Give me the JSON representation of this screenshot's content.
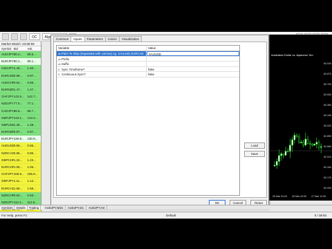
{
  "market_watch": {
    "title": "Market Watch: 23:58:59",
    "headers": [
      "Symbol",
      "Bid",
      "Ask"
    ],
    "rows": [
      {
        "symbol": "AUDJPY",
        "bid": "80.4...",
        "ask": "80.5...",
        "color": "#7ee07e"
      },
      {
        "symbol": "EURJPY",
        "bid": "90.1...",
        "ask": "90.1...",
        "color": "#e8ffe8"
      },
      {
        "symbol": "USDJPY",
        "bid": "1.40...",
        "ask": "1.40...",
        "color": "#7ee07e"
      },
      {
        "symbol": "EURUSD",
        "bid": "0.98...",
        "ask": "0.97...",
        "color": "#7ee07e"
      },
      {
        "symbol": "AUDCHF",
        "bid": "0.64...",
        "ask": "0.65...",
        "color": "#7ee07e"
      },
      {
        "symbol": "EURNZD",
        "bid": "1.47...",
        "ask": "1.47...",
        "color": "#7ee07e"
      },
      {
        "symbol": "CHFJPY",
        "bid": "142.6...",
        "ask": "142.7...",
        "color": "#7ee07e"
      },
      {
        "symbol": "NZDJPY",
        "bid": "77.0...",
        "ask": "77.1...",
        "color": "#7ee07e"
      },
      {
        "symbol": "CADJPY",
        "bid": "86.5...",
        "ask": "86.7...",
        "color": "#7ee07e"
      },
      {
        "symbol": "GBPJPY",
        "bid": "143.1...",
        "ask": "143.3...",
        "color": "#7ee07e"
      },
      {
        "symbol": "GBPUSD",
        "bid": "1.28...",
        "ask": "1.28...",
        "color": "#7ee07e"
      },
      {
        "symbol": "EURGBP",
        "bid": "0.87...",
        "ask": "0.87...",
        "color": "#7ee07e"
      },
      {
        "symbol": "EURJPY",
        "bid": "130.8...",
        "ask": "130.9...",
        "color": "#e8ffe8"
      },
      {
        "symbol": "AUDUSD",
        "bid": "0.66...",
        "ask": "0.66...",
        "color": "#f2f23d"
      },
      {
        "symbol": "NZDCAD",
        "bid": "0.85...",
        "ask": "0.85...",
        "color": "#f2f23d"
      },
      {
        "symbol": "GBPCHF",
        "bid": "1.22...",
        "ask": "1.23...",
        "color": "#f2f23d"
      },
      {
        "symbol": "EURCHF",
        "bid": "1.05...",
        "ask": "1.05...",
        "color": "#f2f23d"
      },
      {
        "symbol": "CHFJPY",
        "bid": "105.8...",
        "ask": "105.9...",
        "color": "#f2f23d"
      },
      {
        "symbol": "GBPJPY",
        "bid": "1.11...",
        "ask": "1.12...",
        "color": "#f2f23d"
      },
      {
        "symbol": "EURCAD",
        "bid": "1.58...",
        "ask": "1.58...",
        "color": "#f2f23d"
      },
      {
        "symbol": "NZDCHF",
        "bid": "0.63...",
        "ask": "0.63...",
        "color": "#7ee07e"
      },
      {
        "symbol": "NZDJPY",
        "bid": "112.4...",
        "ask": "112.5...",
        "color": "#7ee07e"
      },
      {
        "symbol": "USDCAD",
        "bid": "1.41...",
        "ask": "1.41...",
        "color": "#f2f23d"
      },
      {
        "symbol": "USDCHF",
        "bid": "1.27...",
        "ask": "1.27...",
        "color": "#f2f23d"
      },
      {
        "symbol": "AUDNZD",
        "bid": "1.03...",
        "ask": "1.04...",
        "color": "#f2f23d"
      }
    ],
    "tabs": [
      "Symbols",
      "Details",
      "Trading"
    ]
  },
  "toolbar": {
    "label": "Algo Trading",
    "oc_label": "OC"
  },
  "dialog": {
    "tabs": [
      "Common",
      "Inputs",
      "Parameters",
      "Colors",
      "Visualization"
    ],
    "active_tab": "Inputs",
    "grid_headers": [
      "Variable",
      "Value"
    ],
    "rows": [
      {
        "icon": "ab",
        "variable": "Pairs To Skip (Separated with comma) eg. XAUUSD,EURCAD",
        "value": "XAUUSD",
        "selected": true
      },
      {
        "icon": "ab",
        "variable": "Prefix",
        "value": "",
        "selected": false
      },
      {
        "icon": "ab",
        "variable": "Suffix",
        "value": "",
        "selected": false
      },
      {
        "icon": "tf",
        "variable": "Sync Timeframe?",
        "value": "false",
        "selected": false
      },
      {
        "icon": "tf",
        "variable": "Continuous Sync?",
        "value": "false",
        "selected": false
      }
    ],
    "load_label": "Load",
    "save_label": "Save",
    "ok_label": "OK",
    "cancel_label": "Cancel",
    "reset_label": "Reset"
  },
  "chart": {
    "title": "Australian Dollar vs Japanese Yen",
    "prices": [
      "84.040",
      "83.870",
      "83.700",
      "83.530",
      "83.360",
      "83.190",
      "83.020",
      "82.850",
      "82.680",
      "82.510",
      "82.340",
      "82.170",
      "82.000"
    ],
    "dates": [
      "26 Mar 04:00",
      "26 Mar 20:00",
      "27 Mar 12:00"
    ],
    "bull_color": "#ffffff",
    "bear_color": "#000000",
    "wick_color": "#33ff33"
  },
  "bottom_tabs": [
    "AUDJPY,M15",
    "AUDJPY,D1",
    "AUDJPY,H4"
  ],
  "status": {
    "left": "For Help, press F1",
    "middle": "Default",
    "right": "0 / 38 kb"
  }
}
